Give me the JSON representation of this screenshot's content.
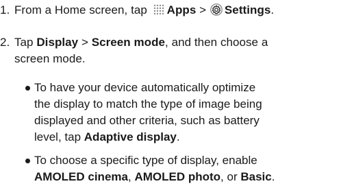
{
  "step1": {
    "number": "1.",
    "prefix": "From a Home screen, tap",
    "apps_label": "Apps",
    "separator": ">",
    "settings_label": "Settings",
    "suffix": ".",
    "apps_icon": "apps-grid-icon",
    "settings_icon": "settings-gear-icon"
  },
  "step2": {
    "number": "2.",
    "tap": "Tap",
    "display_label": "Display",
    "separator": ">",
    "screen_mode_label": "Screen mode",
    "after": ", and then choose a",
    "line2": "screen mode."
  },
  "bullet1": {
    "line1": "To have your device automatically optimize",
    "line2": "the display to match the type of image being",
    "line3": "displayed and other criteria, such as battery",
    "line4_prefix": "level, tap",
    "adaptive_label": "Adaptive display",
    "line4_suffix": "."
  },
  "bullet2": {
    "line1": "To choose a specific type of display, enable",
    "cinema_label": "AMOLED cinema",
    "comma": ",",
    "photo_label": "AMOLED photo",
    "or": ", or",
    "basic_label": "Basic",
    "end": "."
  }
}
